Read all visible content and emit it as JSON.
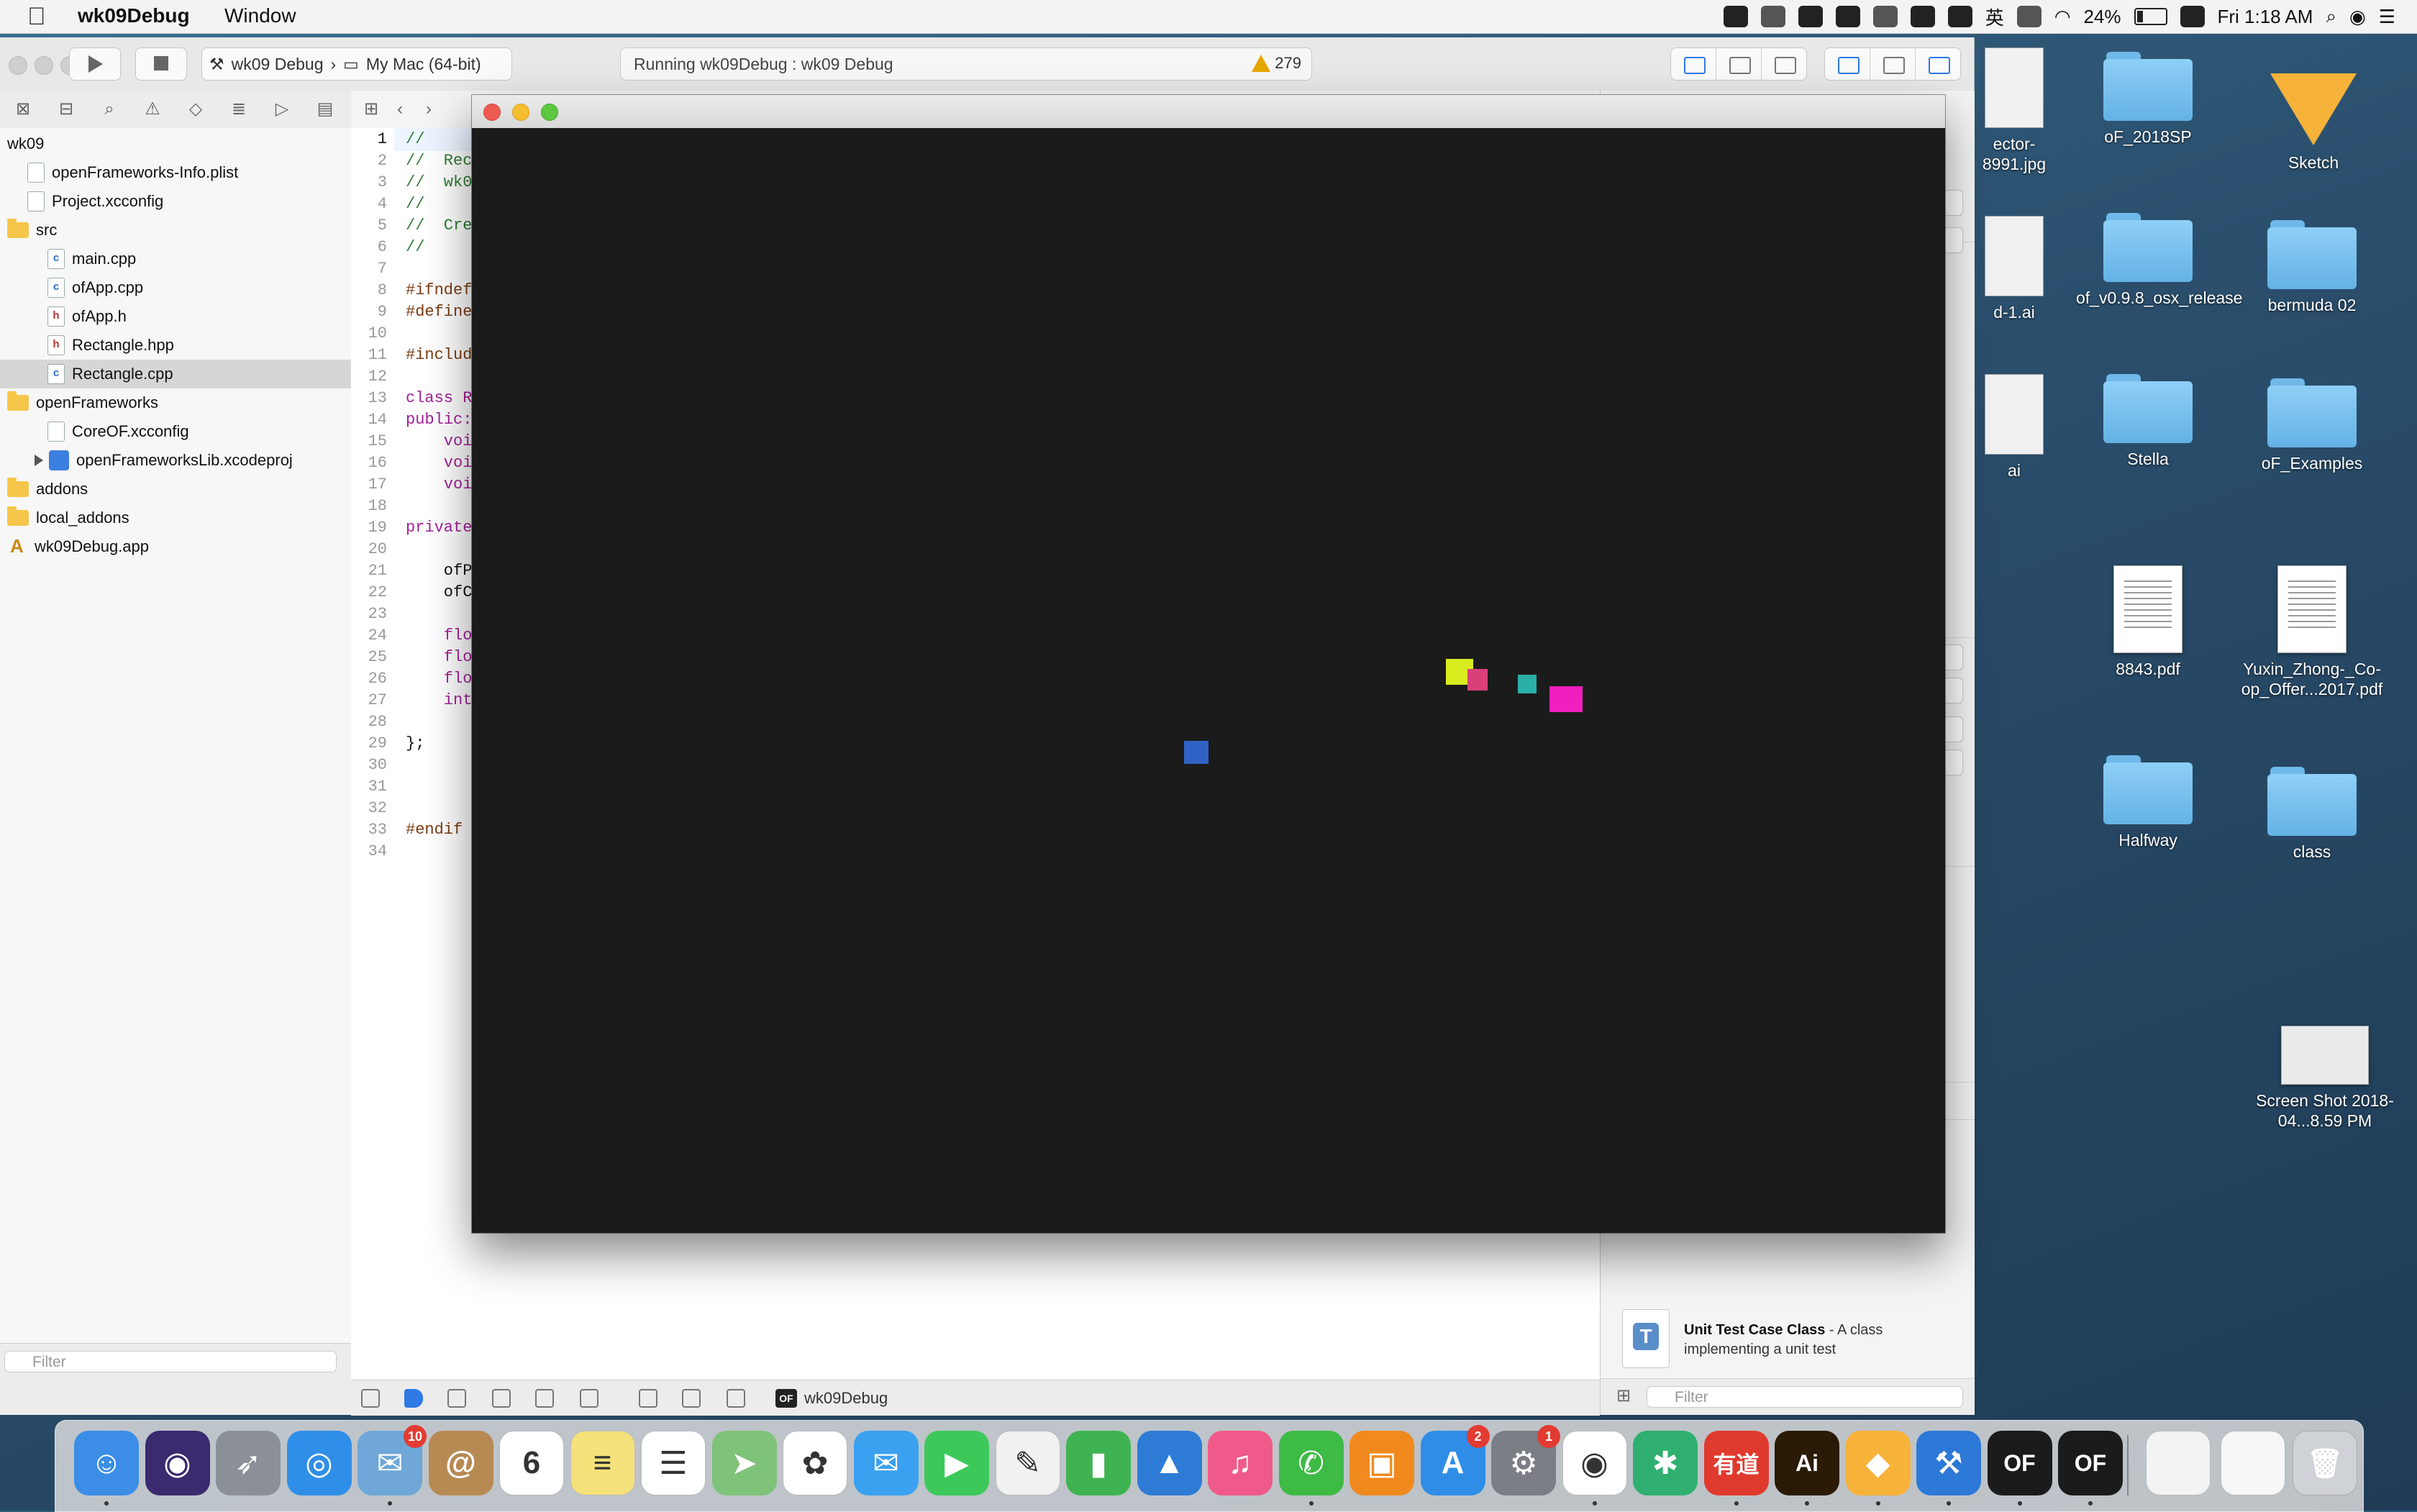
{
  "menubar": {
    "app_name": "wk09Debug",
    "window_menu": "Window",
    "battery": "24%",
    "clock": "Fri 1:18 AM",
    "input_method": "英"
  },
  "toolbar": {
    "scheme_target": "wk09 Debug",
    "scheme_device": "My Mac (64-bit)",
    "activity_status": "Running wk09Debug : wk09 Debug",
    "warning_count": "279"
  },
  "navigator": {
    "filter_placeholder": "Filter",
    "items": [
      {
        "label": "wk09",
        "kind": "project",
        "indent": 0
      },
      {
        "label": "openFrameworks-Info.plist",
        "kind": "file",
        "indent": 1
      },
      {
        "label": "Project.xcconfig",
        "kind": "file",
        "indent": 1
      },
      {
        "label": "src",
        "kind": "folder",
        "indent": 0
      },
      {
        "label": "main.cpp",
        "kind": "cpp",
        "indent": 2
      },
      {
        "label": "ofApp.cpp",
        "kind": "cpp",
        "indent": 2
      },
      {
        "label": "ofApp.h",
        "kind": "h",
        "indent": 2
      },
      {
        "label": "Rectangle.hpp",
        "kind": "h",
        "indent": 2
      },
      {
        "label": "Rectangle.cpp",
        "kind": "cpp",
        "indent": 2,
        "selected": true
      },
      {
        "label": "openFrameworks",
        "kind": "folder",
        "indent": 0
      },
      {
        "label": "CoreOF.xcconfig",
        "kind": "file",
        "indent": 2
      },
      {
        "label": "openFrameworksLib.xcodeproj",
        "kind": "xproj",
        "indent": 1
      },
      {
        "label": "addons",
        "kind": "folder",
        "indent": 0
      },
      {
        "label": "local_addons",
        "kind": "folder",
        "indent": 0
      },
      {
        "label": "wk09Debug.app",
        "kind": "app",
        "indent": 0
      }
    ]
  },
  "editor": {
    "lines": [
      {
        "n": "1",
        "t": "//",
        "c": "comment"
      },
      {
        "n": "2",
        "t": "//  Rec",
        "c": "comment"
      },
      {
        "n": "3",
        "t": "//  wk0",
        "c": "comment"
      },
      {
        "n": "4",
        "t": "//",
        "c": "comment"
      },
      {
        "n": "5",
        "t": "//  Cre",
        "c": "comment"
      },
      {
        "n": "6",
        "t": "//",
        "c": "comment"
      },
      {
        "n": "7",
        "t": "",
        "c": "plain"
      },
      {
        "n": "8",
        "t": "#ifndef",
        "c": "pre"
      },
      {
        "n": "9",
        "t": "#define",
        "c": "pre"
      },
      {
        "n": "10",
        "t": "",
        "c": "plain"
      },
      {
        "n": "11",
        "t": "#includ",
        "c": "pre"
      },
      {
        "n": "12",
        "t": "",
        "c": "plain"
      },
      {
        "n": "13",
        "t": "class R",
        "c": "kw"
      },
      {
        "n": "14",
        "t": "public:",
        "c": "kw"
      },
      {
        "n": "15",
        "t": "    voi",
        "c": "kw"
      },
      {
        "n": "16",
        "t": "    voi",
        "c": "kw"
      },
      {
        "n": "17",
        "t": "    voi",
        "c": "kw"
      },
      {
        "n": "18",
        "t": "",
        "c": "plain"
      },
      {
        "n": "19",
        "t": "private",
        "c": "kw"
      },
      {
        "n": "20",
        "t": "",
        "c": "plain"
      },
      {
        "n": "21",
        "t": "    ofP",
        "c": "plain"
      },
      {
        "n": "22",
        "t": "    ofC",
        "c": "plain"
      },
      {
        "n": "23",
        "t": "",
        "c": "plain"
      },
      {
        "n": "24",
        "t": "    flo",
        "c": "kw"
      },
      {
        "n": "25",
        "t": "    flo",
        "c": "kw"
      },
      {
        "n": "26",
        "t": "    flo",
        "c": "kw"
      },
      {
        "n": "27",
        "t": "    int",
        "c": "kw"
      },
      {
        "n": "28",
        "t": "",
        "c": "plain"
      },
      {
        "n": "29",
        "t": "};",
        "c": "plain"
      },
      {
        "n": "30",
        "t": "",
        "c": "plain"
      },
      {
        "n": "31",
        "t": "",
        "c": "plain"
      },
      {
        "n": "32",
        "t": "",
        "c": "plain"
      },
      {
        "n": "33",
        "t": "#endif",
        "c": "pre"
      },
      {
        "n": "34",
        "t": "",
        "c": "plain"
      }
    ]
  },
  "debug_bar": {
    "target": "wk09Debug"
  },
  "utility": {
    "template_title": "Unit Test Case Class",
    "template_desc": " - A class implementing a unit test",
    "filter_placeholder": "Filter"
  },
  "of_window": {
    "background": "#1b1b1b",
    "rectangles": [
      {
        "color": "#d9ec1f"
      },
      {
        "color": "#d9407a"
      },
      {
        "color": "#2ab0a8"
      },
      {
        "color": "#f01fbd"
      },
      {
        "color": "#2f62c4"
      }
    ]
  },
  "desktop": {
    "items": [
      {
        "label": "ector-\n8991.jpg",
        "kind": "partial"
      },
      {
        "label": "oF_2018SP",
        "kind": "folder"
      },
      {
        "label": "Sketch",
        "kind": "sketch"
      },
      {
        "label": "d-1.ai",
        "kind": "partial"
      },
      {
        "label": "of_v0.9.8_osx_release",
        "kind": "folder"
      },
      {
        "label": "bermuda 02",
        "kind": "folder"
      },
      {
        "label": "ai",
        "kind": "partial"
      },
      {
        "label": "Stella",
        "kind": "folder"
      },
      {
        "label": "oF_Examples",
        "kind": "folder"
      },
      {
        "label": "8843.pdf",
        "kind": "pdf"
      },
      {
        "label": "Yuxin_Zhong-_Co-op_Offer...2017.pdf",
        "kind": "pdf"
      },
      {
        "label": "Halfway",
        "kind": "folder"
      },
      {
        "label": "class",
        "kind": "folder"
      },
      {
        "label": "Screen Shot 2018-04...8.59 PM",
        "kind": "shot"
      }
    ]
  },
  "dock": {
    "apps": [
      {
        "name": "Finder",
        "icon": "finder-icon",
        "color": "#3b8de6",
        "glyph": "☺",
        "running": true
      },
      {
        "name": "Siri",
        "icon": "siri-icon",
        "color": "#3a2a6e",
        "glyph": "◉",
        "running": false
      },
      {
        "name": "Launchpad",
        "icon": "launchpad-icon",
        "color": "#8a8f98",
        "glyph": "➶",
        "running": false
      },
      {
        "name": "Safari",
        "icon": "safari-icon",
        "color": "#2f8fe8",
        "glyph": "◎",
        "running": false
      },
      {
        "name": "Mail",
        "icon": "mail-icon",
        "color": "#6ea7d8",
        "glyph": "✉",
        "badge": "10",
        "running": true
      },
      {
        "name": "Contacts",
        "icon": "contacts-icon",
        "color": "#b78a53",
        "glyph": "@",
        "running": false
      },
      {
        "name": "Calendar",
        "icon": "calendar-icon",
        "color": "#ffffff",
        "glyph": "6",
        "running": false
      },
      {
        "name": "Notes",
        "icon": "notes-icon",
        "color": "#f6e27a",
        "glyph": "≡",
        "running": false
      },
      {
        "name": "Reminders",
        "icon": "reminders-icon",
        "color": "#ffffff",
        "glyph": "☰",
        "running": false
      },
      {
        "name": "Maps",
        "icon": "maps-icon",
        "color": "#7fc37a",
        "glyph": "➤",
        "running": false
      },
      {
        "name": "Photos",
        "icon": "photos-icon",
        "color": "#ffffff",
        "glyph": "✿",
        "running": false
      },
      {
        "name": "Messages",
        "icon": "messages-icon",
        "color": "#3aa0f0",
        "glyph": "✉",
        "running": false
      },
      {
        "name": "FaceTime",
        "icon": "facetime-icon",
        "color": "#3cc95a",
        "glyph": "▶",
        "running": false
      },
      {
        "name": "Script Editor",
        "icon": "script-icon",
        "color": "#f1f1f1",
        "glyph": "✎",
        "running": false
      },
      {
        "name": "Numbers",
        "icon": "numbers-icon",
        "color": "#3fb352",
        "glyph": "▮",
        "running": false
      },
      {
        "name": "Keynote",
        "icon": "keynote-icon",
        "color": "#2e7bd6",
        "glyph": "▲",
        "running": false
      },
      {
        "name": "iTunes",
        "icon": "itunes-icon",
        "color": "#f05a8a",
        "glyph": "♫",
        "running": false
      },
      {
        "name": "WeChat",
        "icon": "wechat-icon",
        "color": "#3dbb45",
        "glyph": "✆",
        "running": true
      },
      {
        "name": "iBooks",
        "icon": "ibooks-icon",
        "color": "#f08a1e",
        "glyph": "▣",
        "running": false
      },
      {
        "name": "App Store",
        "icon": "appstore-icon",
        "color": "#2f8de8",
        "glyph": "A",
        "badge": "2",
        "running": false
      },
      {
        "name": "System Preferences",
        "icon": "system-prefs-icon",
        "color": "#7b7e85",
        "glyph": "⚙",
        "badge": "1",
        "running": false
      },
      {
        "name": "Chrome",
        "icon": "chrome-icon",
        "color": "#ffffff",
        "glyph": "◉",
        "running": true
      },
      {
        "name": "Network Radar",
        "icon": "network-icon",
        "color": "#2fb070",
        "glyph": "✱",
        "running": false
      },
      {
        "name": "Youdao Dict",
        "icon": "youdao-icon",
        "color": "#e03a2e",
        "glyph": "有道",
        "running": true
      },
      {
        "name": "Illustrator",
        "icon": "illustrator-icon",
        "color": "#2b1a05",
        "glyph": "Ai",
        "running": true
      },
      {
        "name": "Sketch",
        "icon": "sketch-icon",
        "color": "#f7b23a",
        "glyph": "◆",
        "running": true
      },
      {
        "name": "Xcode",
        "icon": "xcode-icon",
        "color": "#2c79d8",
        "glyph": "⚒",
        "running": true
      },
      {
        "name": "openFrameworks",
        "icon": "openframeworks-icon",
        "color": "#1b1b1b",
        "glyph": "OF",
        "running": true
      },
      {
        "name": "wk09Debug",
        "icon": "of-debug-icon",
        "color": "#1b1b1b",
        "glyph": "OF",
        "running": true
      }
    ]
  }
}
